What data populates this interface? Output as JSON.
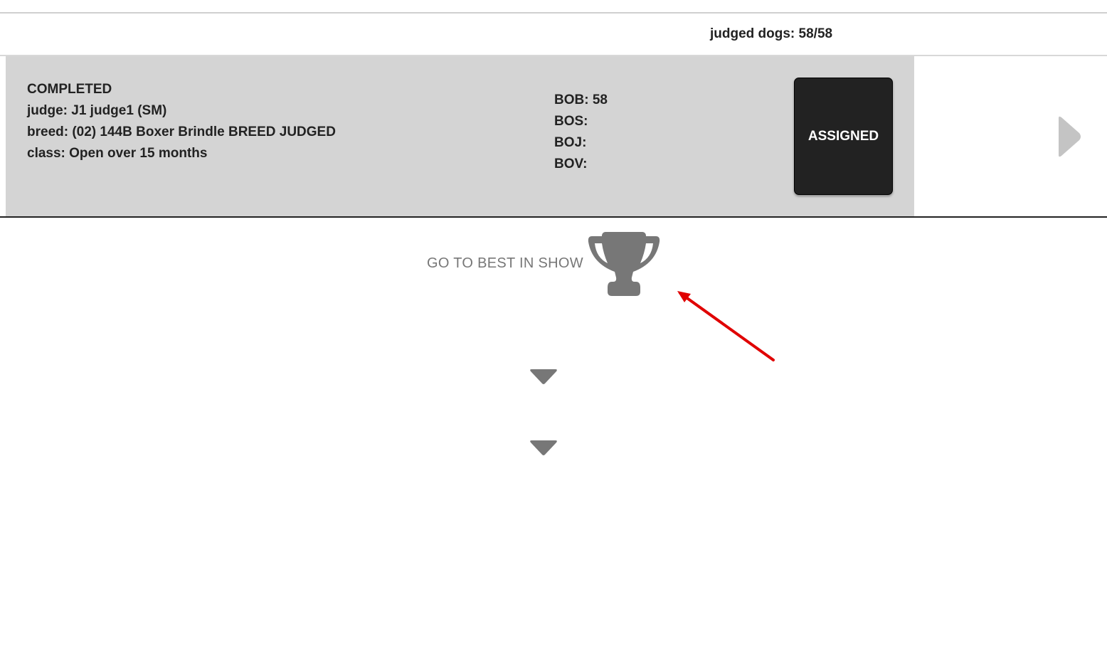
{
  "header": {
    "judged_dogs": "judged dogs: 58/58"
  },
  "card": {
    "status": "COMPLETED",
    "judge": "judge: J1 judge1 (SM)",
    "breed": "breed: (02) 144B Boxer Brindle BREED JUDGED",
    "class": "class: Open over 15 months",
    "awards": {
      "bob": "BOB: 58",
      "bos": "BOS:",
      "boj": "BOJ:",
      "bov": "BOV:"
    },
    "button_label": "ASSIGNED"
  },
  "best_in_show": {
    "label": "GO TO BEST IN SHOW"
  },
  "icons": {
    "next": "chevron-right-icon",
    "trophy": "trophy-icon",
    "expand": "caret-down-icon",
    "annotation": "red-arrow-annotation"
  },
  "colors": {
    "card_bg": "#d4d4d4",
    "button_bg": "#222222",
    "icon_gray": "#777777",
    "annotation_red": "#e00000"
  }
}
